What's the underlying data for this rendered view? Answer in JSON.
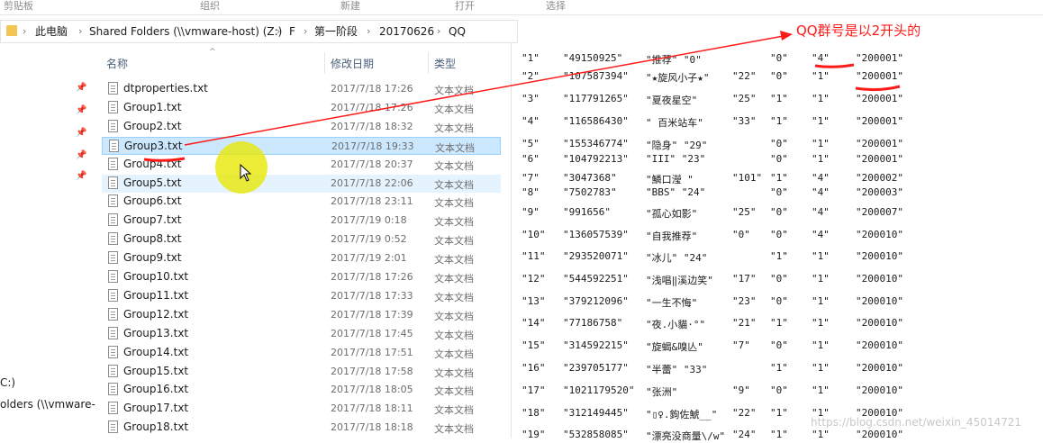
{
  "ribbon": {
    "groups": [
      "剪贴板",
      "组织",
      "新建",
      "打开",
      "选择"
    ]
  },
  "address": {
    "crumbs": [
      "此电脑",
      "Shared Folders (\\\\vmware-host) (Z:)",
      "F",
      "第一阶段",
      "20170626",
      "QQ"
    ]
  },
  "nav": {
    "items": [
      "C:)",
      "olders (\\\\vmware-"
    ]
  },
  "columns": {
    "name": "名称",
    "date": "修改日期",
    "type": "类型"
  },
  "files": [
    {
      "name": "dtproperties.txt",
      "date": "2017/7/18 17:26",
      "type": "文本文档"
    },
    {
      "name": "Group1.txt",
      "date": "2017/7/18 17:26",
      "type": "文本文档"
    },
    {
      "name": "Group2.txt",
      "date": "2017/7/18 18:32",
      "type": "文本文档"
    },
    {
      "name": "Group3.txt",
      "date": "2017/7/18 19:33",
      "type": "文本文档"
    },
    {
      "name": "Group4.txt",
      "date": "2017/7/18 20:37",
      "type": "文本文档"
    },
    {
      "name": "Group5.txt",
      "date": "2017/7/18 22:06",
      "type": "文本文档"
    },
    {
      "name": "Group6.txt",
      "date": "2017/7/18 23:11",
      "type": "文本文档"
    },
    {
      "name": "Group7.txt",
      "date": "2017/7/19 0:18",
      "type": "文本文档"
    },
    {
      "name": "Group8.txt",
      "date": "2017/7/19 0:52",
      "type": "文本文档"
    },
    {
      "name": "Group9.txt",
      "date": "2017/7/19 2:01",
      "type": "文本文档"
    },
    {
      "name": "Group10.txt",
      "date": "2017/7/18 17:26",
      "type": "文本文档"
    },
    {
      "name": "Group11.txt",
      "date": "2017/7/18 17:33",
      "type": "文本文档"
    },
    {
      "name": "Group12.txt",
      "date": "2017/7/18 17:39",
      "type": "文本文档"
    },
    {
      "name": "Group13.txt",
      "date": "2017/7/18 17:45",
      "type": "文本文档"
    },
    {
      "name": "Group14.txt",
      "date": "2017/7/18 17:51",
      "type": "文本文档"
    },
    {
      "name": "Group15.txt",
      "date": "2017/7/18 17:58",
      "type": "文本文档"
    },
    {
      "name": "Group16.txt",
      "date": "2017/7/18 18:05",
      "type": "文本文档"
    },
    {
      "name": "Group17.txt",
      "date": "2017/7/18 18:11",
      "type": "文本文档"
    },
    {
      "name": "Group18.txt",
      "date": "2017/7/18 18:18",
      "type": "文本文档"
    }
  ],
  "selected_index": 3,
  "hover_index": 5,
  "preview": {
    "rows": [
      [
        "\"1\"",
        "\"49150925\"",
        "\"推荐\" \"0\"",
        "\"0\"",
        "\"4\"",
        "\"200001\""
      ],
      [
        "\"2\"",
        "\"107587394\"",
        "\"★旋风小子★\"",
        "\"22\"",
        "\"0\"",
        "\"1\"",
        "\"200001\""
      ],
      [
        "\"3\"",
        "\"117791265\"",
        "\"夏夜星空\"",
        "\"25\"",
        "\"1\"",
        "\"1\"",
        "\"200001\""
      ],
      [
        "\"4\"",
        "\"116586430\"",
        "\" 百米站车\"",
        "\"33\"",
        "\"1\"",
        "\"1\"",
        "\"200001\""
      ],
      [
        "\"5\"",
        "\"155346774\"",
        "\"隐身\" \"29\"",
        "\"0\"",
        "\"1\"",
        "\"200001\""
      ],
      [
        "\"6\"",
        "\"104792213\"",
        "\"III\" \"23\"",
        "\"0\"",
        "\"1\"",
        "\"200001\""
      ],
      [
        "\"7\"",
        "\"3047368\"",
        "\"鱗口瀅 \"",
        "\"101\"",
        "\"1\"",
        "\"4\"",
        "\"200002\""
      ],
      [
        "\"8\"",
        "\"7502783\"",
        "\"BBS\" \"24\"",
        "\"0\"",
        "\"4\"",
        "\"200003\""
      ],
      [
        "\"9\"",
        "\"991656\"",
        "\"孤心如影\"",
        "\"25\"",
        "\"0\"",
        "\"4\"",
        "\"200007\""
      ],
      [
        "\"10\"",
        "\"136057539\"",
        "\"自我推荐\"",
        "\"0\"",
        "\"0\"",
        "\"4\"",
        "\"200010\""
      ],
      [
        "\"11\"",
        "\"293520071\"",
        "\"冰儿\" \"24\"",
        "\"1\"",
        "\"1\"",
        "\"200010\""
      ],
      [
        "\"12\"",
        "\"544592251\"",
        "\"浅唱‖溪边笑\"",
        "\"17\"",
        "\"0\"",
        "\"1\"",
        "\"200010\""
      ],
      [
        "\"13\"",
        "\"379212096\"",
        "\"一生不悔\"",
        "\"23\"",
        "\"0\"",
        "\"1\"",
        "\"200010\""
      ],
      [
        "\"14\"",
        "\"77186758\"",
        "\"夜.小貓·°\"",
        "\"21\"",
        "\"1\"",
        "\"1\"",
        "\"200010\""
      ],
      [
        "\"15\"",
        "\"314592215\"",
        "\"旋蝎&嗅亾\"",
        "\"7\"",
        "\"0\"",
        "\"1\"",
        "\"200010\""
      ],
      [
        "\"16\"",
        "\"239705177\"",
        "\"半蕾\" \"33\"",
        "\"1\"",
        "\"1\"",
        "\"200010\""
      ],
      [
        "\"17\"",
        "\"1021179520\"",
        "\"张洲\"",
        "\"9\"",
        "\"0\"",
        "\"1\"",
        "\"200010\""
      ],
      [
        "\"18\"",
        "\"312149445\"",
        "\"▯♀.鉤佐鯱__\"",
        "\"22\"",
        "\"1\"",
        "\"1\"",
        "\"200010\""
      ],
      [
        "\"19\"",
        "\"532858085\"",
        "\"漂亮没商量\\/w\"",
        "\"24\"",
        "\"1\"",
        "\"1\"",
        "\"200010\""
      ]
    ]
  },
  "annotation": {
    "text": "QQ群号是以2开头的",
    "color": "#ff1a1a"
  },
  "watermark": "https://blog.csdn.net/weixin_45014721",
  "colors": {
    "selection": "#cce8ff",
    "annotation": "#ff1a1a",
    "halo": "#e8e800"
  }
}
